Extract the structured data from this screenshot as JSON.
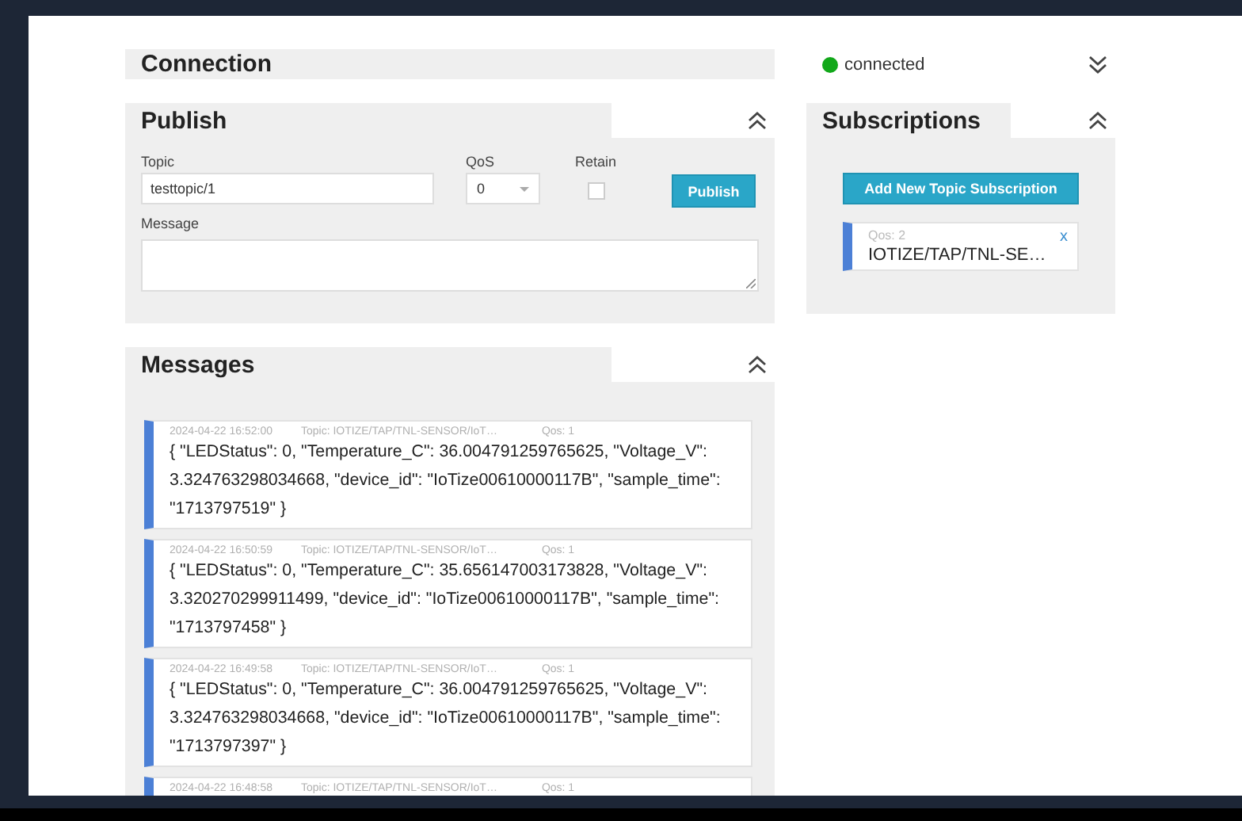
{
  "connection": {
    "title": "Connection",
    "connected": true,
    "status": "connected",
    "expanded": false
  },
  "publish": {
    "title": "Publish",
    "expanded": true,
    "topic_label": "Topic",
    "topic": "testtopic/1",
    "qos_label": "QoS",
    "qos": "0",
    "retain_label": "Retain",
    "retain": false,
    "button": "Publish",
    "message_label": "Message"
  },
  "subscriptions": {
    "title": "Subscriptions",
    "expanded": true,
    "add_button": "Add New Topic Subscription",
    "items": [
      {
        "qos": "Qos: 2",
        "topic": "IOTIZE/TAP/TNL-SE…",
        "remove": "x"
      }
    ]
  },
  "messages": {
    "title": "Messages",
    "expanded": true,
    "items": [
      {
        "time": "2024-04-22 16:52:00",
        "topic": "Topic: IOTIZE/TAP/TNL-SENSOR/IoT…",
        "qos": "Qos: 1",
        "payload": "{ \"LEDStatus\": 0, \"Temperature_C\": 36.004791259765625, \"Voltage_V\": 3.324763298034668, \"device_id\": \"IoTize00610000117B\", \"sample_time\": \"1713797519\" }"
      },
      {
        "time": "2024-04-22 16:50:59",
        "topic": "Topic: IOTIZE/TAP/TNL-SENSOR/IoT…",
        "qos": "Qos: 1",
        "payload": "{ \"LEDStatus\": 0, \"Temperature_C\": 35.656147003173828, \"Voltage_V\": 3.320270299911499, \"device_id\": \"IoTize00610000117B\", \"sample_time\": \"1713797458\" }"
      },
      {
        "time": "2024-04-22 16:49:58",
        "topic": "Topic: IOTIZE/TAP/TNL-SENSOR/IoT…",
        "qos": "Qos: 1",
        "payload": "{ \"LEDStatus\": 0, \"Temperature_C\": 36.004791259765625, \"Voltage_V\": 3.324763298034668, \"device_id\": \"IoTize00610000117B\", \"sample_time\": \"1713797397\" }"
      },
      {
        "time": "2024-04-22 16:48:58",
        "topic": "Topic: IOTIZE/TAP/TNL-SENSOR/IoT…",
        "qos": "Qos: 1"
      }
    ]
  }
}
